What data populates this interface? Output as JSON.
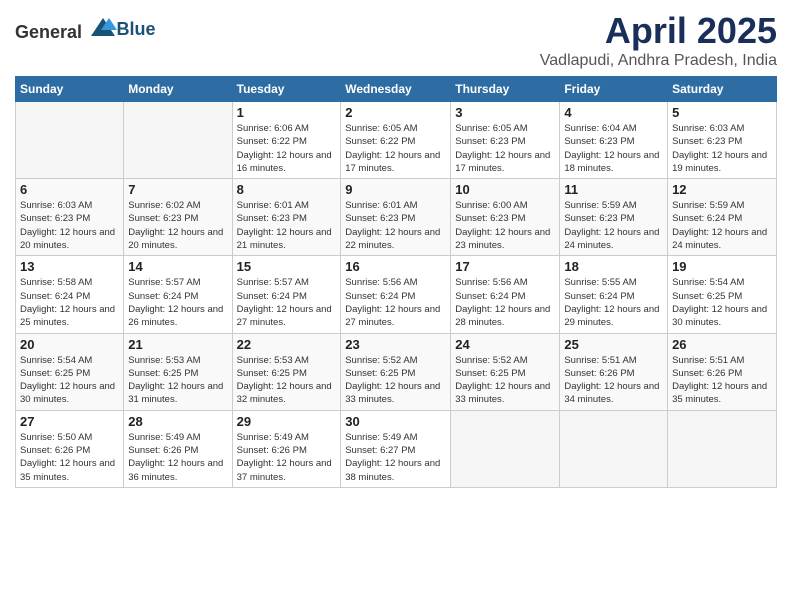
{
  "logo": {
    "text_general": "General",
    "text_blue": "Blue"
  },
  "title": {
    "month": "April 2025",
    "location": "Vadlapudi, Andhra Pradesh, India"
  },
  "headers": [
    "Sunday",
    "Monday",
    "Tuesday",
    "Wednesday",
    "Thursday",
    "Friday",
    "Saturday"
  ],
  "weeks": [
    [
      {
        "day": "",
        "info": ""
      },
      {
        "day": "",
        "info": ""
      },
      {
        "day": "1",
        "info": "Sunrise: 6:06 AM\nSunset: 6:22 PM\nDaylight: 12 hours and 16 minutes."
      },
      {
        "day": "2",
        "info": "Sunrise: 6:05 AM\nSunset: 6:22 PM\nDaylight: 12 hours and 17 minutes."
      },
      {
        "day": "3",
        "info": "Sunrise: 6:05 AM\nSunset: 6:23 PM\nDaylight: 12 hours and 17 minutes."
      },
      {
        "day": "4",
        "info": "Sunrise: 6:04 AM\nSunset: 6:23 PM\nDaylight: 12 hours and 18 minutes."
      },
      {
        "day": "5",
        "info": "Sunrise: 6:03 AM\nSunset: 6:23 PM\nDaylight: 12 hours and 19 minutes."
      }
    ],
    [
      {
        "day": "6",
        "info": "Sunrise: 6:03 AM\nSunset: 6:23 PM\nDaylight: 12 hours and 20 minutes."
      },
      {
        "day": "7",
        "info": "Sunrise: 6:02 AM\nSunset: 6:23 PM\nDaylight: 12 hours and 20 minutes."
      },
      {
        "day": "8",
        "info": "Sunrise: 6:01 AM\nSunset: 6:23 PM\nDaylight: 12 hours and 21 minutes."
      },
      {
        "day": "9",
        "info": "Sunrise: 6:01 AM\nSunset: 6:23 PM\nDaylight: 12 hours and 22 minutes."
      },
      {
        "day": "10",
        "info": "Sunrise: 6:00 AM\nSunset: 6:23 PM\nDaylight: 12 hours and 23 minutes."
      },
      {
        "day": "11",
        "info": "Sunrise: 5:59 AM\nSunset: 6:23 PM\nDaylight: 12 hours and 24 minutes."
      },
      {
        "day": "12",
        "info": "Sunrise: 5:59 AM\nSunset: 6:24 PM\nDaylight: 12 hours and 24 minutes."
      }
    ],
    [
      {
        "day": "13",
        "info": "Sunrise: 5:58 AM\nSunset: 6:24 PM\nDaylight: 12 hours and 25 minutes."
      },
      {
        "day": "14",
        "info": "Sunrise: 5:57 AM\nSunset: 6:24 PM\nDaylight: 12 hours and 26 minutes."
      },
      {
        "day": "15",
        "info": "Sunrise: 5:57 AM\nSunset: 6:24 PM\nDaylight: 12 hours and 27 minutes."
      },
      {
        "day": "16",
        "info": "Sunrise: 5:56 AM\nSunset: 6:24 PM\nDaylight: 12 hours and 27 minutes."
      },
      {
        "day": "17",
        "info": "Sunrise: 5:56 AM\nSunset: 6:24 PM\nDaylight: 12 hours and 28 minutes."
      },
      {
        "day": "18",
        "info": "Sunrise: 5:55 AM\nSunset: 6:24 PM\nDaylight: 12 hours and 29 minutes."
      },
      {
        "day": "19",
        "info": "Sunrise: 5:54 AM\nSunset: 6:25 PM\nDaylight: 12 hours and 30 minutes."
      }
    ],
    [
      {
        "day": "20",
        "info": "Sunrise: 5:54 AM\nSunset: 6:25 PM\nDaylight: 12 hours and 30 minutes."
      },
      {
        "day": "21",
        "info": "Sunrise: 5:53 AM\nSunset: 6:25 PM\nDaylight: 12 hours and 31 minutes."
      },
      {
        "day": "22",
        "info": "Sunrise: 5:53 AM\nSunset: 6:25 PM\nDaylight: 12 hours and 32 minutes."
      },
      {
        "day": "23",
        "info": "Sunrise: 5:52 AM\nSunset: 6:25 PM\nDaylight: 12 hours and 33 minutes."
      },
      {
        "day": "24",
        "info": "Sunrise: 5:52 AM\nSunset: 6:25 PM\nDaylight: 12 hours and 33 minutes."
      },
      {
        "day": "25",
        "info": "Sunrise: 5:51 AM\nSunset: 6:26 PM\nDaylight: 12 hours and 34 minutes."
      },
      {
        "day": "26",
        "info": "Sunrise: 5:51 AM\nSunset: 6:26 PM\nDaylight: 12 hours and 35 minutes."
      }
    ],
    [
      {
        "day": "27",
        "info": "Sunrise: 5:50 AM\nSunset: 6:26 PM\nDaylight: 12 hours and 35 minutes."
      },
      {
        "day": "28",
        "info": "Sunrise: 5:49 AM\nSunset: 6:26 PM\nDaylight: 12 hours and 36 minutes."
      },
      {
        "day": "29",
        "info": "Sunrise: 5:49 AM\nSunset: 6:26 PM\nDaylight: 12 hours and 37 minutes."
      },
      {
        "day": "30",
        "info": "Sunrise: 5:49 AM\nSunset: 6:27 PM\nDaylight: 12 hours and 38 minutes."
      },
      {
        "day": "",
        "info": ""
      },
      {
        "day": "",
        "info": ""
      },
      {
        "day": "",
        "info": ""
      }
    ]
  ]
}
